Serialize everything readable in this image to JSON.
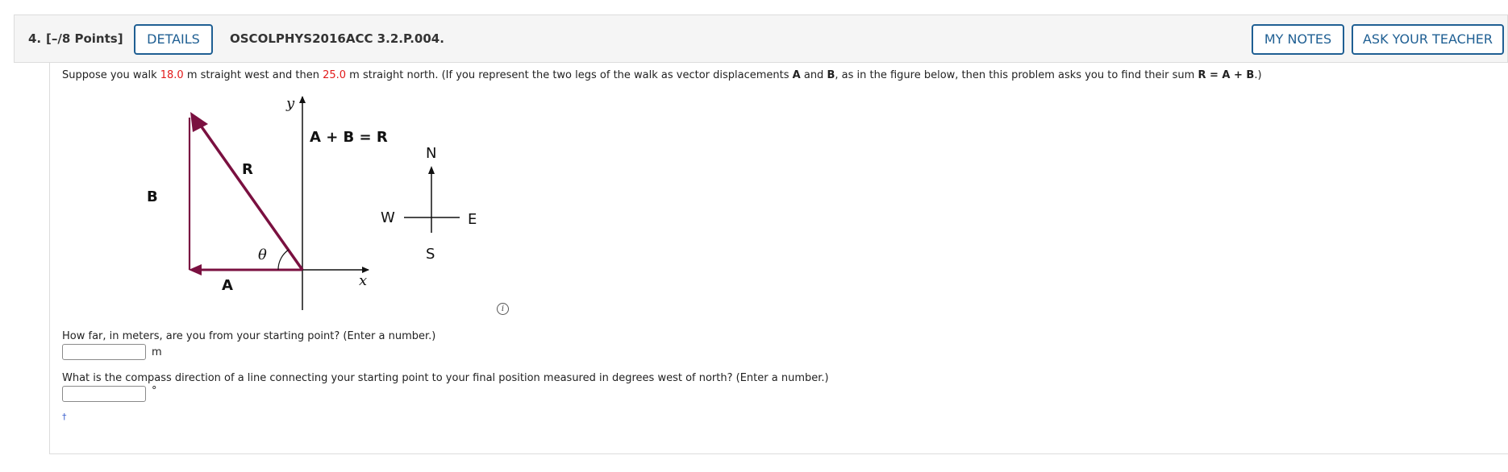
{
  "header": {
    "number": "4.",
    "points": "[–/8 Points]",
    "details_label": "DETAILS",
    "problem_id": "OSCOLPHYS2016ACC 3.2.P.004.",
    "my_notes_label": "MY NOTES",
    "ask_teacher_label": "ASK YOUR TEACHER"
  },
  "prompt": {
    "t1": "Suppose you walk ",
    "west_value": "18.0",
    "t2": " m straight west and then ",
    "north_value": "25.0",
    "t3": " m straight north. (If you represent the two legs of the walk as vector displacements ",
    "vecA": "A",
    "t4": " and ",
    "vecB": "B",
    "t5": ", as in the figure below, then this problem asks you to find their sum ",
    "sum_expr": "R = A + B",
    "t6": ".)"
  },
  "figure": {
    "y_axis": "y",
    "x_axis": "x",
    "equation": "A + B = R",
    "label_R": "R",
    "label_B": "B",
    "label_A": "A",
    "label_theta": "θ",
    "compass": {
      "n": "N",
      "s": "S",
      "e": "E",
      "w": "W"
    },
    "vector_color": "#7a1040"
  },
  "info_icon": "i",
  "questions": [
    {
      "text": "How far, in meters, are you from your starting point? (Enter a number.)",
      "value": "",
      "unit": "m"
    },
    {
      "text": "What is the compass direction of a line connecting your starting point to your final position measured in degrees west of north? (Enter a number.)",
      "value": "",
      "unit": "°"
    }
  ],
  "link_glyph": "†"
}
